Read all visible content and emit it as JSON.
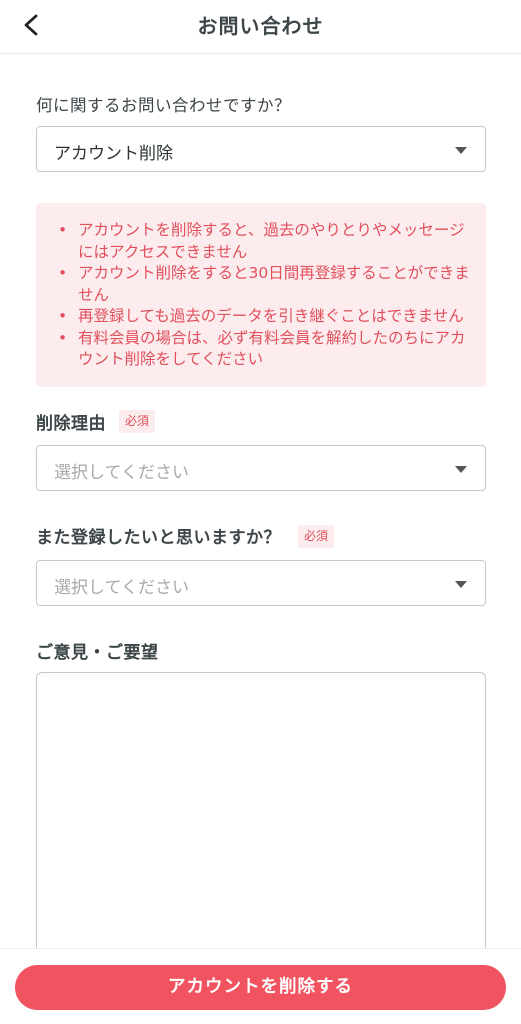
{
  "header": {
    "title": "お問い合わせ",
    "back_icon": "chevron-left-icon"
  },
  "form": {
    "topic": {
      "label": "何に関するお問い合わせですか？",
      "value": "アカウント削除"
    },
    "warnings": [
      "アカウントを削除すると、過去のやりとりやメッセージにはアクセスできません",
      "アカウント削除をすると30日間再登録することができません",
      "再登録しても過去のデータを引き継ぐことはできません",
      "有料会員の場合は、必ず有料会員を解約したのちにアカウント削除をしてください"
    ],
    "reason": {
      "label": "削除理由",
      "required_badge": "必須",
      "placeholder": "選択してください"
    },
    "reregister": {
      "label": "また登録したいと思いますか？",
      "required_badge": "必須",
      "placeholder": "選択してください"
    },
    "feedback": {
      "label": "ご意見・ご要望",
      "value": ""
    }
  },
  "footer": {
    "delete_button_label": "アカウントを削除する"
  },
  "colors": {
    "accent": "#f25360",
    "warning_bg": "#fdecee",
    "warning_text": "#e0505c",
    "text": "#3c4548"
  }
}
